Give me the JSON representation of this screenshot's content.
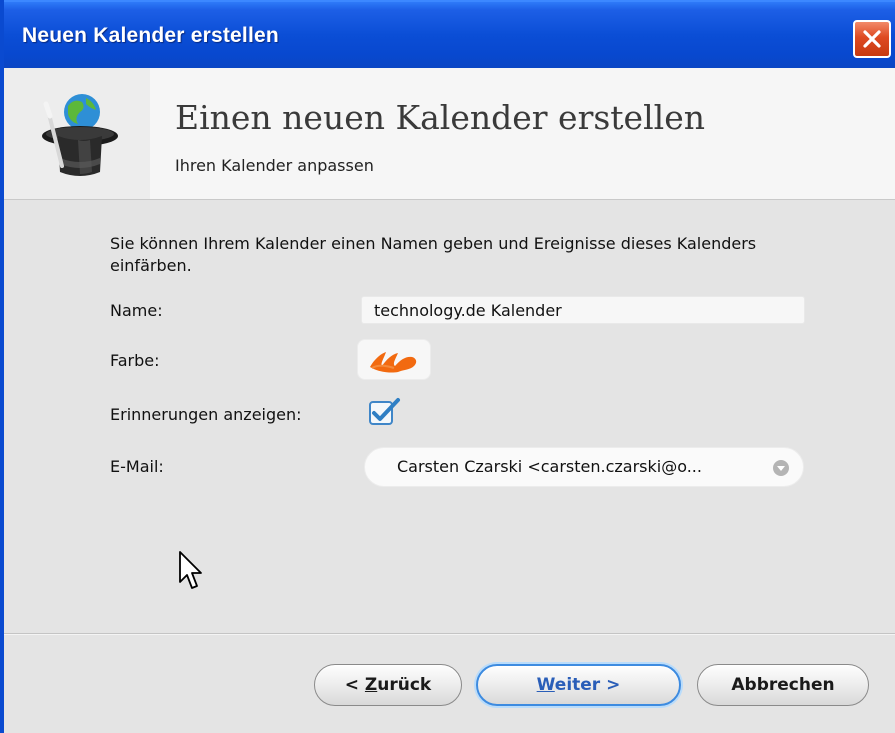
{
  "window": {
    "title": "Neuen Kalender erstellen"
  },
  "header": {
    "title": "Einen neuen Kalender erstellen",
    "subtitle": "Ihren Kalender anpassen",
    "icon": "wizard-hat-icon"
  },
  "form": {
    "description": "Sie können Ihrem Kalender einen Namen geben und Ereignisse dieses Kalenders einfärben.",
    "name_label": "Name:",
    "name_value": "technology.de Kalender",
    "color_label": "Farbe:",
    "color_value": "#f26a10",
    "reminders_label": "Erinnerungen anzeigen:",
    "reminders_checked": true,
    "email_label": "E-Mail:",
    "email_value": "Carsten Czarski <carsten.czarski@o..."
  },
  "buttons": {
    "back_prefix": "< ",
    "back_mnemonic": "Z",
    "back_rest": "urück",
    "next_mnemonic": "W",
    "next_rest": "eiter >",
    "cancel": "Abbrechen"
  },
  "colors": {
    "titlebar": "#0b4ed6",
    "accent_orange": "#f26a10",
    "checkbox_blue": "#2f7fc4"
  }
}
